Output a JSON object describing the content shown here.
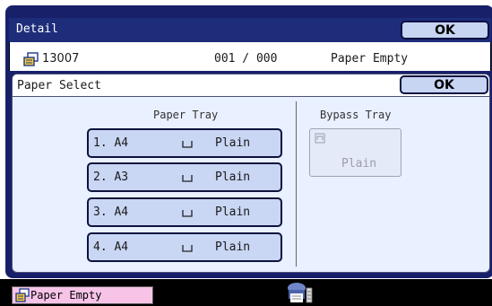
{
  "header": {
    "title": "Detail",
    "ok_label": "OK"
  },
  "info": {
    "job_number": "13007",
    "count": "001 / 000",
    "status": "Paper Empty"
  },
  "panel": {
    "title": "Paper Select",
    "ok_label": "OK",
    "paper_tray_title": "Paper Tray",
    "bypass_tray_title": "Bypass Tray",
    "trays": [
      {
        "label": "1. A4",
        "type": "Plain"
      },
      {
        "label": "2. A3",
        "type": "Plain"
      },
      {
        "label": "3. A4",
        "type": "Plain"
      },
      {
        "label": "4. A4",
        "type": "Plain"
      }
    ],
    "bypass": {
      "type": "Plain"
    }
  },
  "status_bar": {
    "message": "Paper Empty"
  },
  "icons": [
    "job-icon",
    "paper-tray-icon",
    "bypass-icon",
    "warning-icon",
    "printer-icon"
  ],
  "colors": {
    "frame": "#18206a",
    "header": "#1e2d7a",
    "panel": "#e9f0ff",
    "button": "#c9d6f4",
    "status_pill": "#f7c4e8"
  }
}
